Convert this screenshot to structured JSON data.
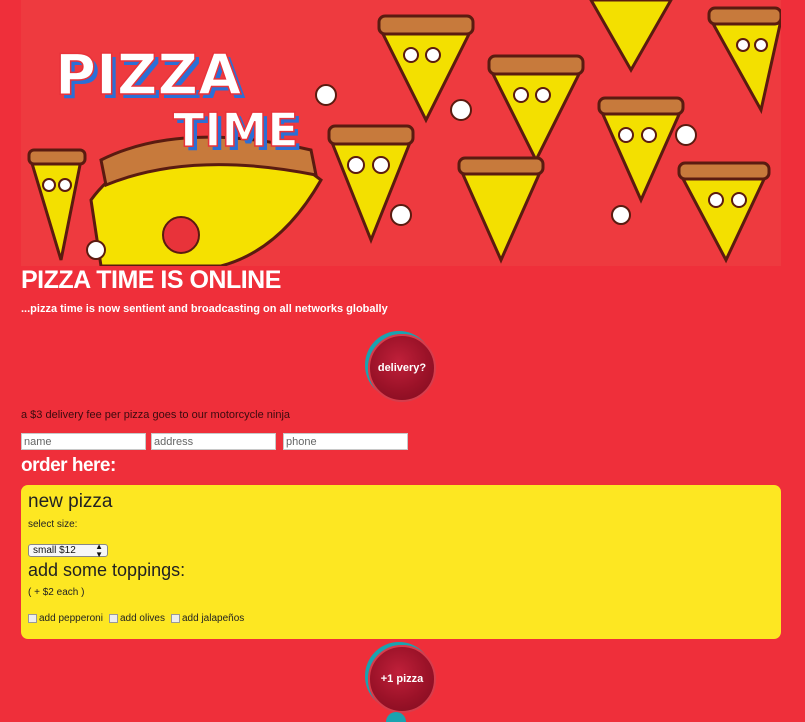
{
  "banner": {
    "logo_line1": "PIZZA",
    "logo_line2": "TIME",
    "icon": "pizza-banner-illustration"
  },
  "header": {
    "title": "PIZZA TIME IS ONLINE",
    "subtitle": "...pizza time is now sentient and broadcasting on all networks globally"
  },
  "delivery": {
    "button_label": "delivery?",
    "note": "a $3 delivery fee per pizza goes to our motorcycle ninja"
  },
  "form": {
    "name_placeholder": "name",
    "address_placeholder": "address",
    "phone_placeholder": "phone"
  },
  "order": {
    "heading": "order here:",
    "card": {
      "title": "new pizza",
      "size_label": "select size:",
      "size_selected": "small $12",
      "toppings_title": "add some toppings:",
      "toppings_note": "( + $2 each )",
      "toppings": [
        "add pepperoni",
        "add olives",
        "add jalapeños"
      ]
    },
    "add_button_label": "+1 pizza"
  },
  "colors": {
    "background": "#ef2f3a",
    "card": "#fde722",
    "button": "#9b1228",
    "button_ring": "#1aa3b0"
  }
}
